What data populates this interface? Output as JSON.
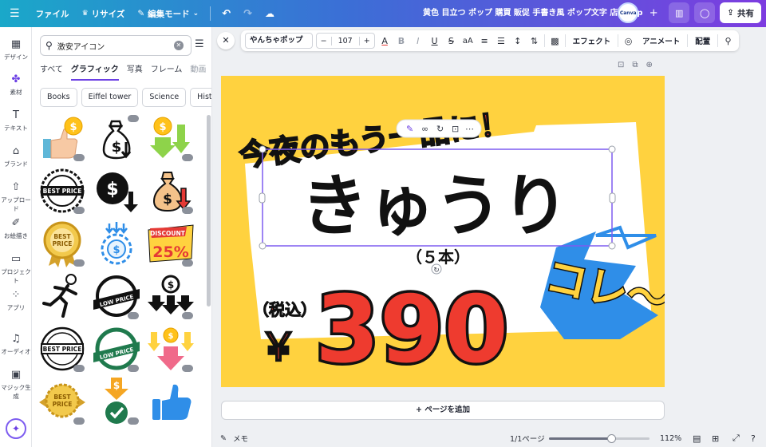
{
  "topbar": {
    "menu_icon": "hamburger-icon",
    "file_label": "ファイル",
    "resize_label": "リサイズ",
    "edit_mode_label": "編集モード",
    "doc_title": "黄色 目立つ ポップ 購買 販促 手書き風 ポップ文字 店頭pop",
    "avatar_text": "Canva",
    "share_label": "共有"
  },
  "rail": {
    "items": [
      {
        "label": "デザイン",
        "icon": "layout-icon"
      },
      {
        "label": "素材",
        "icon": "elements-icon"
      },
      {
        "label": "テキスト",
        "icon": "text-icon"
      },
      {
        "label": "ブランド",
        "icon": "brand-icon"
      },
      {
        "label": "アップロード",
        "icon": "upload-icon"
      },
      {
        "label": "お絵描き",
        "icon": "pen-icon"
      },
      {
        "label": "プロジェクト",
        "icon": "folder-icon"
      },
      {
        "label": "アプリ",
        "icon": "apps-icon"
      },
      {
        "label": "オーディオ",
        "icon": "music-icon"
      },
      {
        "label": "マジック生成",
        "icon": "magic-icon"
      }
    ]
  },
  "panel": {
    "search_value": "激安アイコン",
    "tabs": [
      "すべて",
      "グラフィック",
      "写真",
      "フレーム",
      "動画"
    ],
    "chips": [
      "Books",
      "Eiffel tower",
      "Science",
      "History"
    ],
    "graphics": [
      {
        "name": "thumbs-up-coin-graphic"
      },
      {
        "name": "money-bag-down-graphic"
      },
      {
        "name": "coin-arrows-down-graphic"
      },
      {
        "name": "best-price-badge-graphic",
        "text": "BEST PRICE"
      },
      {
        "name": "dollar-down-arrow-graphic"
      },
      {
        "name": "money-bag-red-arrow-graphic"
      },
      {
        "name": "best-price-gold-ribbon-graphic",
        "text": "BEST PRICE"
      },
      {
        "name": "dollar-coin-arrows-graphic"
      },
      {
        "name": "discount-25-graphic",
        "text": "DISCOUNT",
        "text2": "25%"
      },
      {
        "name": "running-man-graphic"
      },
      {
        "name": "low-price-circle-graphic",
        "text": "LOW PRICE"
      },
      {
        "name": "coin-black-arrows-graphic"
      },
      {
        "name": "best-price-stamp-graphic",
        "text": "BEST PRICE"
      },
      {
        "name": "low-price-green-graphic",
        "text": "LOW PRICE"
      },
      {
        "name": "coin-pink-arrows-graphic"
      },
      {
        "name": "best-price-gold-graphic",
        "text": "BEST PRICE"
      },
      {
        "name": "dollar-check-graphic"
      },
      {
        "name": "thumbs-up-blue-graphic"
      }
    ]
  },
  "toolbar": {
    "font_name": "やんちゃポップ",
    "font_size": "107",
    "effects_label": "エフェクト",
    "animate_label": "アニメート",
    "position_label": "配置"
  },
  "canvas": {
    "headline": "今夜のもう一品に！",
    "product": "きゅうり",
    "quantity": "（５本）",
    "tax_label": "（税込）",
    "currency": "￥",
    "price": "390",
    "slogan": "コレ〜"
  },
  "add_page_label": "+ ページを追加",
  "bottom": {
    "notes_label": "メモ",
    "page_indicator": "1/1ページ",
    "zoom": "112%",
    "zoom_fraction": 0.62
  },
  "colors": {
    "accent": "#6b3fe4",
    "page_bg": "#ffd23f",
    "price_red": "#ee3b2f",
    "blue_burst": "#2f8ee8"
  }
}
